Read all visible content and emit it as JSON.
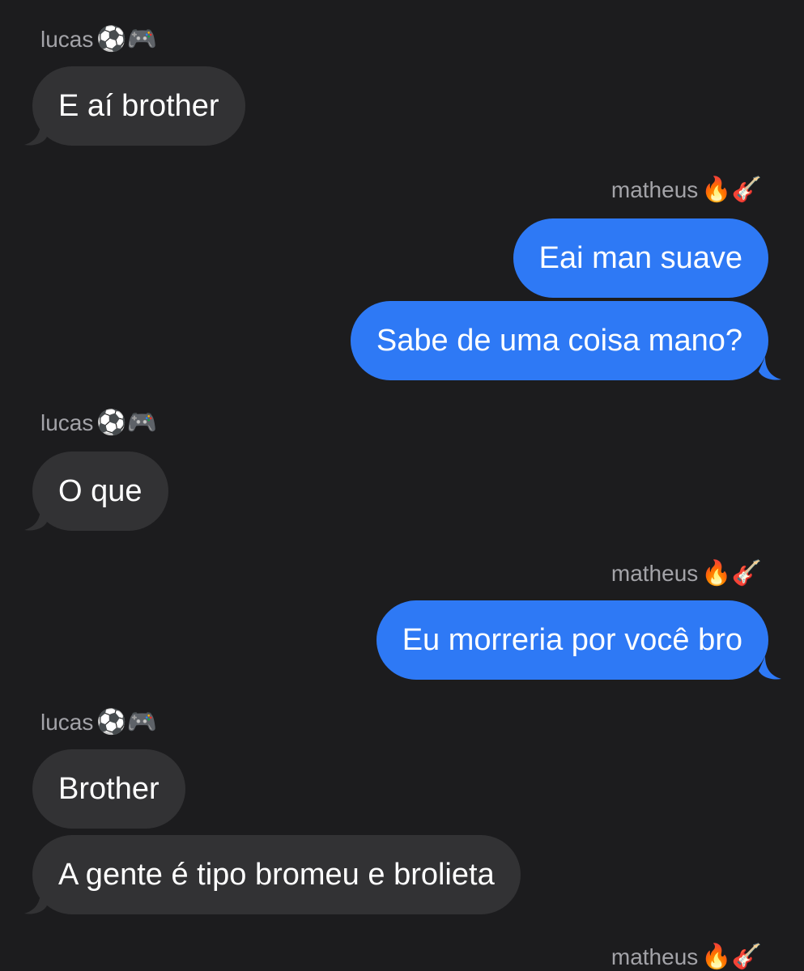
{
  "messages": [
    {
      "type": "name",
      "side": "left",
      "text": "lucas",
      "emoji": "⚽🎮",
      "icon": "soccer-ball-and-gamepad-icon"
    },
    {
      "type": "bubble",
      "side": "left",
      "text": "E aí brother"
    },
    {
      "type": "name",
      "side": "right",
      "text": "matheus",
      "emoji": "🔥🎸",
      "icon": "fire-and-guitar-icon"
    },
    {
      "type": "bubble",
      "side": "right",
      "text": "Eai man suave"
    },
    {
      "type": "bubble",
      "side": "right",
      "text": "Sabe de uma coisa mano?"
    },
    {
      "type": "name",
      "side": "left",
      "text": "lucas",
      "emoji": "⚽🎮",
      "icon": "soccer-ball-and-gamepad-icon"
    },
    {
      "type": "bubble",
      "side": "left",
      "text": "O que"
    },
    {
      "type": "name",
      "side": "right",
      "text": "matheus",
      "emoji": "🔥🎸",
      "icon": "fire-and-guitar-icon"
    },
    {
      "type": "bubble",
      "side": "right",
      "text": "Eu morreria por você bro"
    },
    {
      "type": "name",
      "side": "left",
      "text": "lucas",
      "emoji": "⚽🎮",
      "icon": "soccer-ball-and-gamepad-icon"
    },
    {
      "type": "bubble",
      "side": "left",
      "text": "Brother"
    },
    {
      "type": "bubble",
      "side": "left",
      "text": "A gente é tipo bromeu e brolieta"
    },
    {
      "type": "name",
      "side": "right",
      "text": "matheus",
      "emoji": "🔥🎸",
      "icon": "fire-and-guitar-icon"
    }
  ],
  "colors": {
    "background": "#1c1c1e",
    "incoming_bubble": "#323234",
    "outgoing_bubble": "#2e79f5",
    "sender_name": "#a3a3a8"
  }
}
